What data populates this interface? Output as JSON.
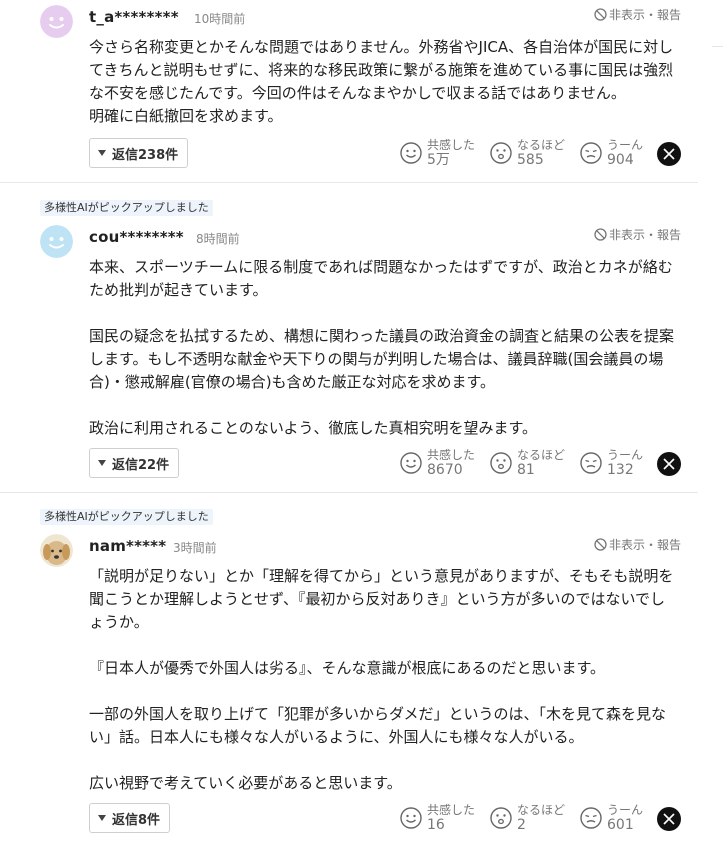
{
  "comments": [
    {
      "pick_label": "",
      "username": "t_a********",
      "time": "10時間前",
      "report_label": "非表示・報告",
      "body": "今さら名称変更とかそんな問題ではありません。外務省やJICA、各自治体が国民に対し\nてきちんと説明もせずに、将来的な移民政策に繋がる施策を進めている事に国民は強烈\nな不安を感じたんです。今回の件はそんなまやかしで収まる話ではありません。\n明確に白紙撤回を求めます。",
      "reply_label": "返信238件",
      "reactions": [
        {
          "label": "共感した",
          "count": "5万"
        },
        {
          "label": "なるほど",
          "count": "585"
        },
        {
          "label": "うーん",
          "count": "904"
        }
      ],
      "avatar": {
        "type": "smile",
        "color": "#e6cdef"
      }
    },
    {
      "pick_label": "多様性AIがピックアップしました",
      "username": "cou********",
      "time": "8時間前",
      "report_label": "非表示・報告",
      "body": "本来、スポーツチームに限る制度であれば問題なかったはずですが、政治とカネが絡む\nため批判が起きています。\n\n国民の疑念を払拭するため、構想に関わった議員の政治資金の調査と結果の公表を提案\nします。もし不透明な献金や天下りの関与が判明した場合は、議員辞職(国会議員の場\n合)・懲戒解雇(官僚の場合)も含めた厳正な対応を求めます。\n\n政治に利用されることのないよう、徹底した真相究明を望みます。",
      "reply_label": "返信22件",
      "reactions": [
        {
          "label": "共感した",
          "count": "8670"
        },
        {
          "label": "なるほど",
          "count": "81"
        },
        {
          "label": "うーん",
          "count": "132"
        }
      ],
      "avatar": {
        "type": "smile",
        "color": "#bde3f5"
      }
    },
    {
      "pick_label": "多様性AIがピックアップしました",
      "username": "nam*****",
      "time": "3時間前",
      "report_label": "非表示・報告",
      "body": "「説明が足りない」とか「理解を得てから」という意見がありますが、そもそも説明を\n聞こうとか理解しようとせず、『最初から反対ありき』という方が多いのではないでし\nょうか。\n\n『日本人が優秀で外国人は劣る』、そんな意識が根底にあるのだと思います。\n\n一部の外国人を取り上げて「犯罪が多いからダメだ」というのは、「木を見て森を見な\nい」話。日本人にも様々な人がいるように、外国人にも様々な人がいる。\n\n広い視野で考えていく必要があると思います。",
      "reply_label": "返信8件",
      "reactions": [
        {
          "label": "共感した",
          "count": "16"
        },
        {
          "label": "なるほど",
          "count": "2"
        },
        {
          "label": "うーん",
          "count": "601"
        }
      ],
      "avatar": {
        "type": "dog",
        "color": "#d9b98a"
      }
    }
  ],
  "colors": {
    "accent_pick_bg": "#eef4fb",
    "x_button": "#111111"
  },
  "icons": [
    "smile-face-icon",
    "thumbs-face-icon",
    "hmm-face-icon",
    "x-logo-icon",
    "ban-icon",
    "chevron-down-icon"
  ]
}
